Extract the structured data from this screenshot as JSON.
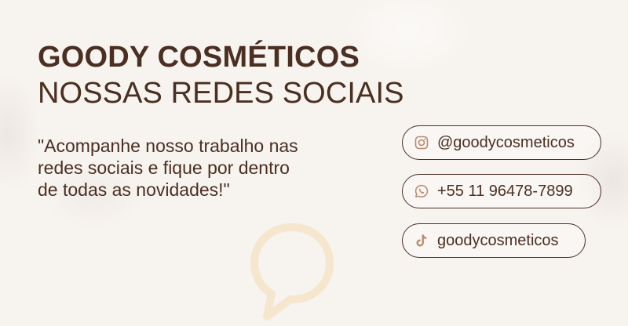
{
  "header": {
    "brand": "GOODY COSMÉTICOS",
    "subtitle": "NOSSAS REDES SOCIAIS"
  },
  "quote_lines": [
    "\"Acompanhe nosso trabalho nas",
    "redes sociais e fique por dentro",
    "de todas as novidades!\""
  ],
  "socials": [
    {
      "icon": "instagram-icon",
      "label": "@goodycosmeticos"
    },
    {
      "icon": "whatsapp-icon",
      "label": "+55 11 96478-7899"
    },
    {
      "icon": "tiktok-icon",
      "label": "goodycosmeticos"
    }
  ],
  "colors": {
    "text": "#4a2f22",
    "background": "#f7f3ef",
    "icon_accent": "#b98a6e",
    "deco_bubble": "#f4e2c2"
  }
}
